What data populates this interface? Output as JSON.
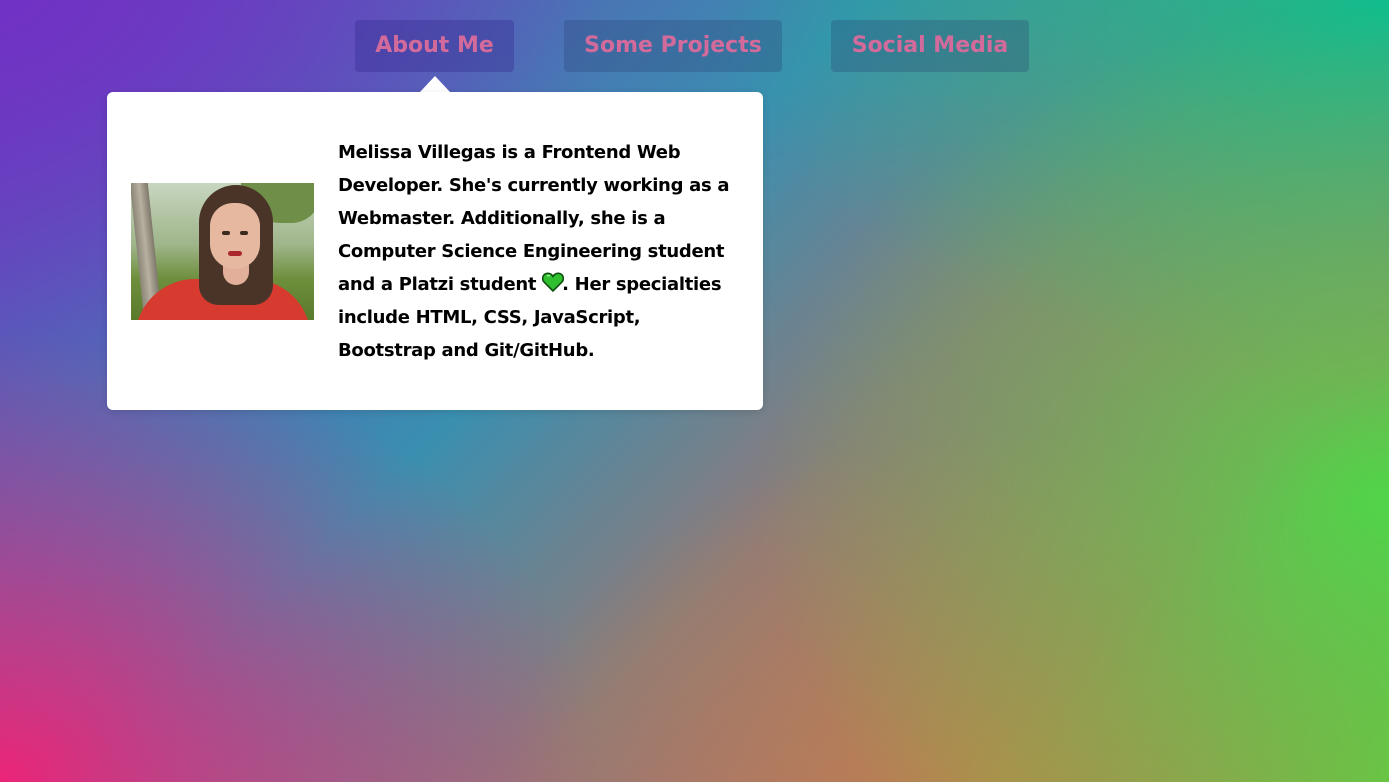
{
  "nav": {
    "items": [
      {
        "label": "About Me"
      },
      {
        "label": "Some Projects"
      },
      {
        "label": "Social Media"
      }
    ]
  },
  "about": {
    "bio_before_icon": "Melissa Villegas is a Frontend Web Developer. She's currently working as a Webmaster. Additionally, she is a Computer Science Engineering student and a Platzi student",
    "bio_after_icon": ". Her specialties include HTML, CSS, JavaScript, Bootstrap and Git/GitHub.",
    "inline_icon": "green-heart-icon"
  },
  "colors": {
    "nav_text": "#d26b9c",
    "card_background": "#ffffff",
    "heart": "#2fbf2f"
  }
}
